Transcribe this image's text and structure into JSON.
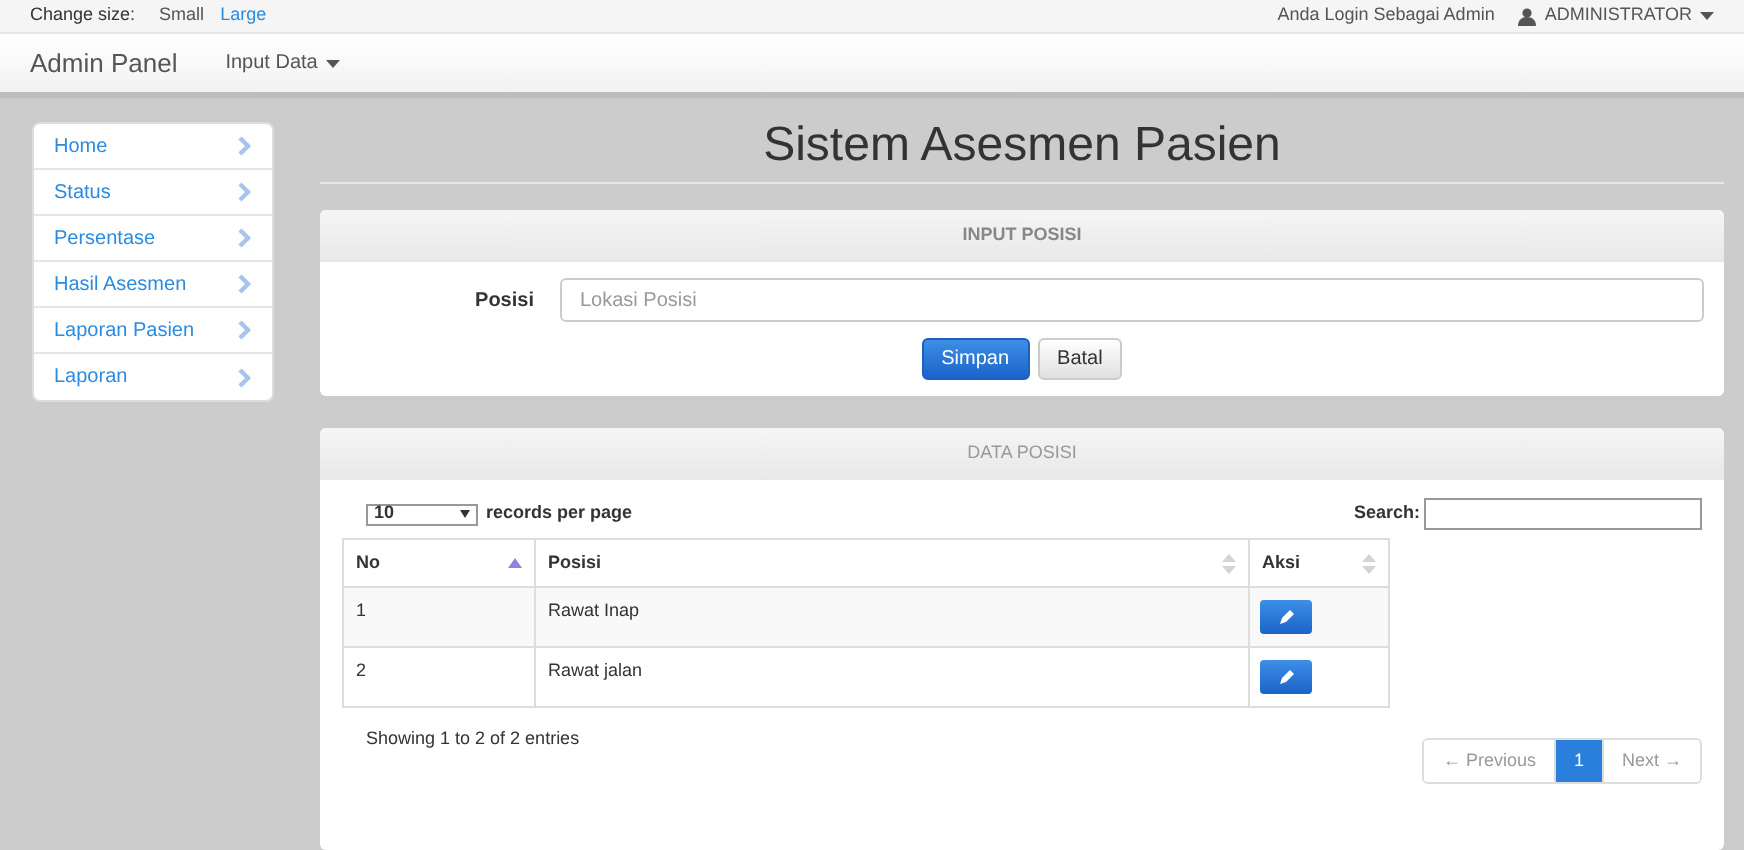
{
  "topbar": {
    "size_label": "Change size:",
    "sizes": [
      {
        "label": "Small",
        "selected": true
      },
      {
        "label": "Large",
        "selected": false
      }
    ],
    "login_text": "Anda Login Sebagai Admin",
    "user_menu": "ADMINISTRATOR"
  },
  "navbar": {
    "brand": "Admin Panel",
    "menus": [
      "Input Data"
    ]
  },
  "sidebar": {
    "items": [
      {
        "label": "Home"
      },
      {
        "label": "Status"
      },
      {
        "label": "Persentase"
      },
      {
        "label": "Hasil Asesmen"
      },
      {
        "label": "Laporan Pasien"
      },
      {
        "label": "Laporan"
      }
    ]
  },
  "page_title": "Sistem Asesmen Pasien",
  "input_panel": {
    "title": "INPUT POSISI",
    "field_label": "Posisi",
    "placeholder": "Lokasi Posisi",
    "buttons": [
      {
        "label": "Simpan",
        "kind": "primary"
      },
      {
        "label": "Batal",
        "kind": "default"
      }
    ]
  },
  "data_panel": {
    "title": "DATA POSISI",
    "page_size": "10",
    "page_size_label": "records per page",
    "search_label": "Search:",
    "table": {
      "columns": [
        {
          "label": "No",
          "sorted": true
        },
        {
          "label": "Posisi",
          "sorted": false
        },
        {
          "label": "Aksi",
          "sorted": false
        }
      ],
      "rows": [
        {
          "no": "1",
          "posisi": "Rawat Inap"
        },
        {
          "no": "2",
          "posisi": "Rawat jalan"
        }
      ]
    },
    "info": "Showing 1 to 2 of 2 entries",
    "pagination": [
      {
        "label": "← Previous",
        "selected": false,
        "disabled": true
      },
      {
        "label": "1",
        "selected": true,
        "disabled": false
      },
      {
        "label": "Next →",
        "selected": false,
        "disabled": true
      }
    ]
  }
}
